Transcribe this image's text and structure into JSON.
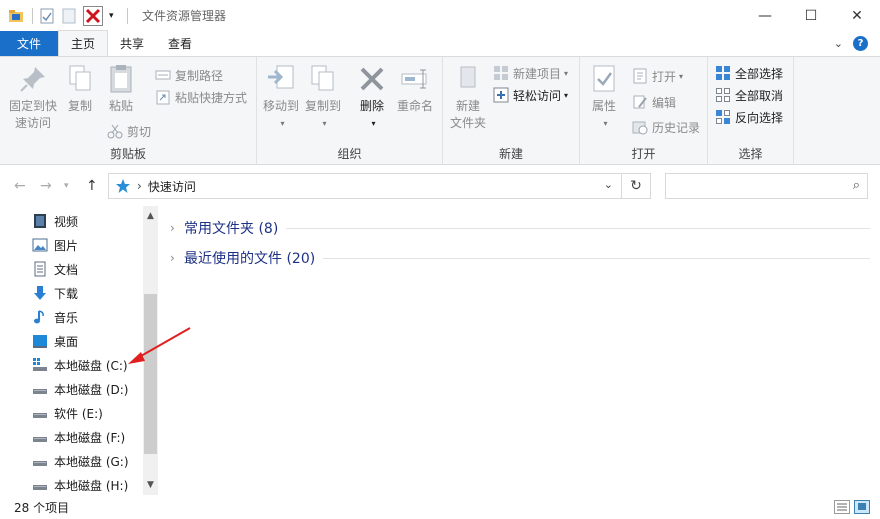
{
  "window": {
    "title": "文件资源管理器",
    "minimize": "—",
    "maximize": "☐",
    "close": "✕"
  },
  "tabs": [
    {
      "label": "文件"
    },
    {
      "label": "主页"
    },
    {
      "label": "共享"
    },
    {
      "label": "查看"
    }
  ],
  "ribbon": {
    "clipboard": {
      "label": "剪贴板",
      "pin": "固定到快速访问",
      "pin_line1": "固定到快",
      "pin_line2": "速访问",
      "copy": "复制",
      "paste": "粘贴",
      "copy_path": "复制路径",
      "paste_shortcut": "粘贴快捷方式",
      "cut": "剪切"
    },
    "organize": {
      "label": "组织",
      "move_to": "移动到",
      "copy_to": "复制到",
      "delete": "删除",
      "rename": "重命名"
    },
    "new": {
      "label": "新建",
      "new_folder_line1": "新建",
      "new_folder_line2": "文件夹",
      "new_item": "新建项目",
      "easy_access": "轻松访问"
    },
    "open": {
      "label": "打开",
      "properties": "属性",
      "open": "打开",
      "edit": "编辑",
      "history": "历史记录"
    },
    "select": {
      "label": "选择",
      "select_all": "全部选择",
      "select_none": "全部取消",
      "invert": "反向选择"
    }
  },
  "address": {
    "path": "快速访问",
    "separator": "›"
  },
  "nav_items": [
    {
      "label": "视频",
      "icon": "video-folder-icon"
    },
    {
      "label": "图片",
      "icon": "pictures-folder-icon"
    },
    {
      "label": "文档",
      "icon": "documents-folder-icon"
    },
    {
      "label": "下载",
      "icon": "download-icon"
    },
    {
      "label": "音乐",
      "icon": "music-icon"
    },
    {
      "label": "桌面",
      "icon": "desktop-icon"
    },
    {
      "label": "本地磁盘 (C:)",
      "icon": "system-drive-icon"
    },
    {
      "label": "本地磁盘 (D:)",
      "icon": "drive-icon"
    },
    {
      "label": "软件 (E:)",
      "icon": "drive-icon"
    },
    {
      "label": "本地磁盘 (F:)",
      "icon": "drive-icon"
    },
    {
      "label": "本地磁盘 (G:)",
      "icon": "drive-icon"
    },
    {
      "label": "本地磁盘 (H:)",
      "icon": "drive-icon"
    }
  ],
  "sections": [
    {
      "label": "常用文件夹 (8)"
    },
    {
      "label": "最近使用的文件 (20)"
    }
  ],
  "status": {
    "count": "28 个项目"
  },
  "colors": {
    "accent": "#1a6fc9",
    "annotation_arrow": "#e02020",
    "section_title": "#1e3287"
  }
}
